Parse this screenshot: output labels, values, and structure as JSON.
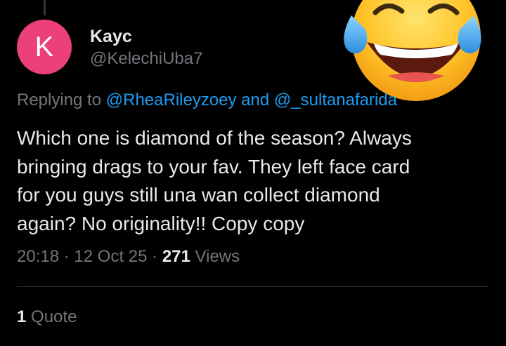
{
  "tweet": {
    "author": {
      "avatar_letter": "K",
      "avatar_color": "#ec407a",
      "display_name": "Kayc",
      "handle": "@KelechiUba7"
    },
    "reply_context": {
      "prefix": "Replying to",
      "user1": "@RheaRileyzoey",
      "and": "and",
      "user2": "@_sultanafarida"
    },
    "body_lines": [
      "Which one is diamond of the season? Always",
      "bringing drags to your fav. They left face card",
      "for you guys still una wan collect diamond",
      "again? No originality!! Copy copy"
    ],
    "meta": {
      "time": "20:18",
      "sep1": "·",
      "date": "12 Oct 25",
      "sep2": "·",
      "views_count": "271",
      "views_label": "Views"
    },
    "engagement": {
      "quote_count": "1",
      "quote_label": "Quote"
    },
    "overlay": {
      "icon": "face-with-tears-of-joy-emoji"
    }
  },
  "colors": {
    "background": "#000000",
    "primary_text": "#e7e9ea",
    "secondary_text": "#71767b",
    "link": "#1d9bf0",
    "divider": "#2f3336"
  }
}
